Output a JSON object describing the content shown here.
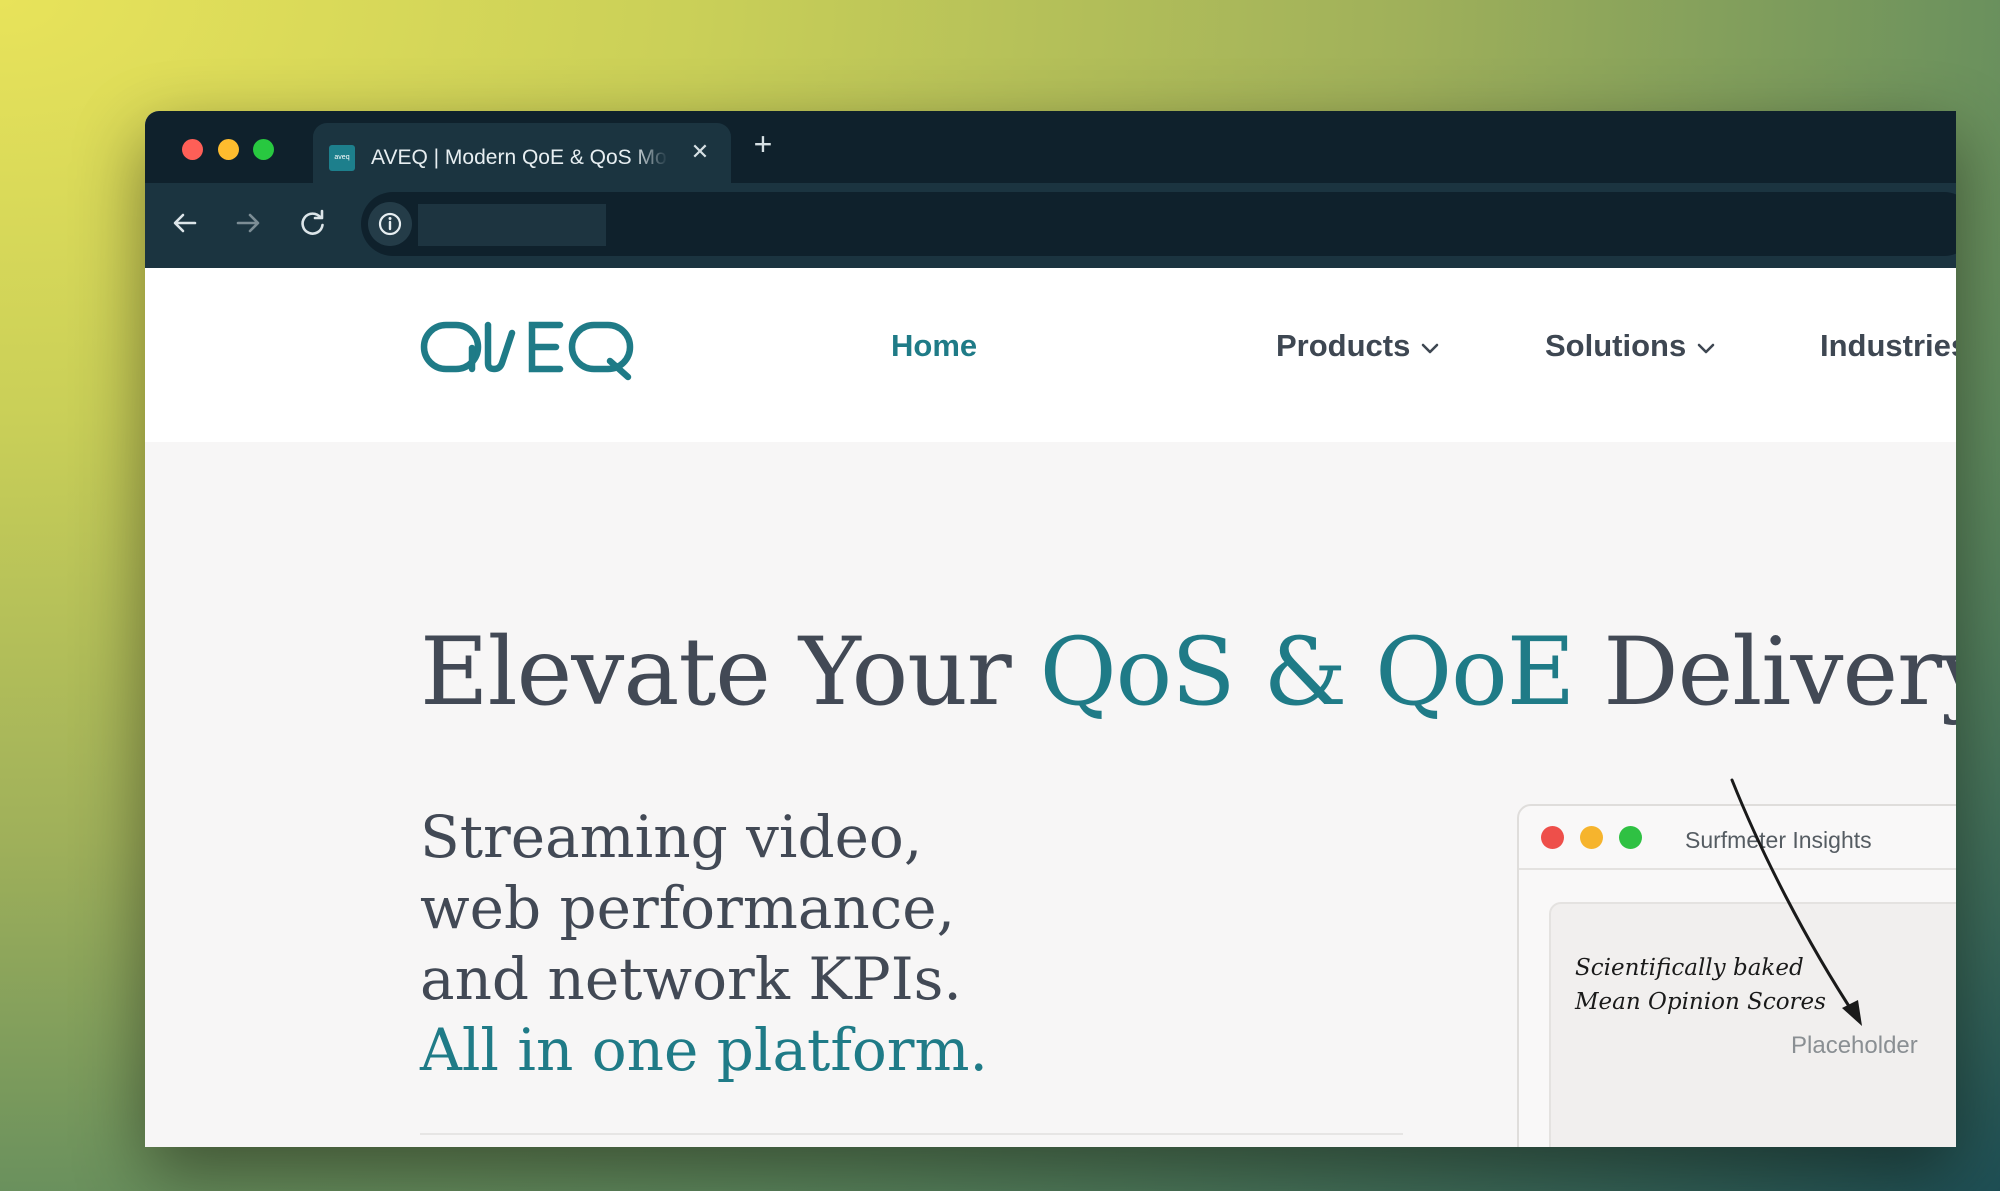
{
  "browser": {
    "tab": {
      "favicon_text": "aveq",
      "title": "AVEQ | Modern QoE & QoS Monitoring",
      "close": "✕"
    },
    "new_tab": "+",
    "url": ""
  },
  "site": {
    "logo_text": "aveq",
    "brand_color": "#1f7b87",
    "nav": [
      {
        "label": "Home",
        "active": true,
        "dropdown": false
      },
      {
        "label": "Products",
        "active": false,
        "dropdown": true
      },
      {
        "label": "Solutions",
        "active": false,
        "dropdown": true
      },
      {
        "label": "Industries",
        "active": false,
        "dropdown": false
      }
    ]
  },
  "hero": {
    "title_pre": "Elevate Your ",
    "title_accent": "QoS & QoE",
    "title_post": " Delivery",
    "sub": [
      "Streaming video,",
      "web performance,",
      "and network KPIs."
    ],
    "sub_accent": "All in one platform."
  },
  "insights": {
    "title": "Surfmeter Insights",
    "placeholder": "Placeholder",
    "annotation": [
      "Scientifically baked",
      "Mean Opinion Scores"
    ]
  }
}
